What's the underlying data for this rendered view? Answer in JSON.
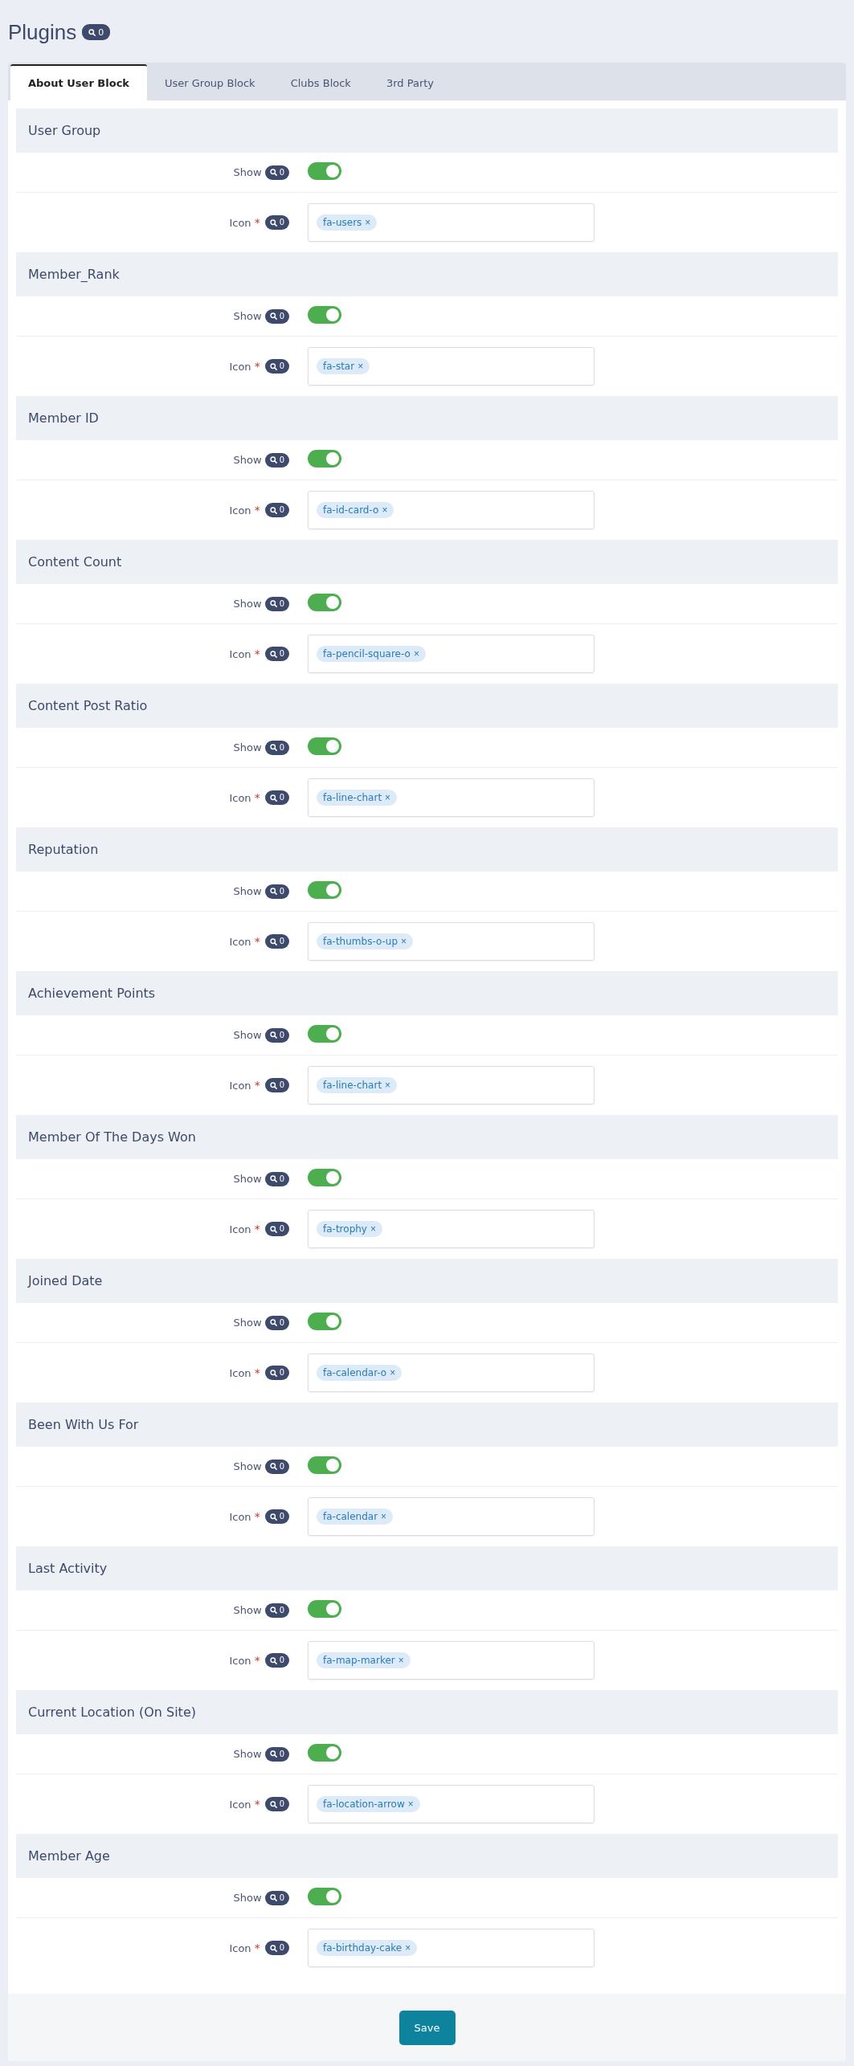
{
  "page": {
    "title": "Plugins",
    "badge": "0"
  },
  "tabs": [
    {
      "label": "About User Block",
      "selected": true
    },
    {
      "label": "User Group Block",
      "selected": false
    },
    {
      "label": "Clubs Block",
      "selected": false
    },
    {
      "label": "3rd Party",
      "selected": false
    }
  ],
  "sections": [
    {
      "title": "User Group",
      "show": {
        "label": "Show",
        "badge": "0",
        "on": true
      },
      "icon": {
        "label": "Icon",
        "required_mark": "*",
        "badge": "0",
        "tags": [
          {
            "text": "fa-users",
            "remove": "×"
          }
        ]
      }
    },
    {
      "title": "Member_Rank",
      "show": {
        "label": "Show",
        "badge": "0",
        "on": true
      },
      "icon": {
        "label": "Icon",
        "required_mark": "*",
        "badge": "0",
        "tags": [
          {
            "text": "fa-star",
            "remove": "×"
          }
        ]
      }
    },
    {
      "title": "Member ID",
      "show": {
        "label": "Show",
        "badge": "0",
        "on": true
      },
      "icon": {
        "label": "Icon",
        "required_mark": "*",
        "badge": "0",
        "tags": [
          {
            "text": "fa-id-card-o",
            "remove": "×"
          }
        ]
      }
    },
    {
      "title": "Content Count",
      "show": {
        "label": "Show",
        "badge": "0",
        "on": true
      },
      "icon": {
        "label": "Icon",
        "required_mark": "*",
        "badge": "0",
        "tags": [
          {
            "text": "fa-pencil-square-o",
            "remove": "×"
          }
        ]
      }
    },
    {
      "title": "Content Post Ratio",
      "show": {
        "label": "Show",
        "badge": "0",
        "on": true
      },
      "icon": {
        "label": "Icon",
        "required_mark": "*",
        "badge": "0",
        "tags": [
          {
            "text": "fa-line-chart",
            "remove": "×"
          }
        ]
      }
    },
    {
      "title": "Reputation",
      "show": {
        "label": "Show",
        "badge": "0",
        "on": true
      },
      "icon": {
        "label": "Icon",
        "required_mark": "*",
        "badge": "0",
        "tags": [
          {
            "text": "fa-thumbs-o-up",
            "remove": "×"
          }
        ]
      }
    },
    {
      "title": "Achievement Points",
      "show": {
        "label": "Show",
        "badge": "0",
        "on": true
      },
      "icon": {
        "label": "Icon",
        "required_mark": "*",
        "badge": "0",
        "tags": [
          {
            "text": "fa-line-chart",
            "remove": "×"
          }
        ]
      }
    },
    {
      "title": "Member Of The Days Won",
      "show": {
        "label": "Show",
        "badge": "0",
        "on": true
      },
      "icon": {
        "label": "Icon",
        "required_mark": "*",
        "badge": "0",
        "tags": [
          {
            "text": "fa-trophy",
            "remove": "×"
          }
        ]
      }
    },
    {
      "title": "Joined Date",
      "show": {
        "label": "Show",
        "badge": "0",
        "on": true
      },
      "icon": {
        "label": "Icon",
        "required_mark": "*",
        "badge": "0",
        "tags": [
          {
            "text": "fa-calendar-o",
            "remove": "×"
          }
        ]
      }
    },
    {
      "title": "Been With Us For",
      "show": {
        "label": "Show",
        "badge": "0",
        "on": true
      },
      "icon": {
        "label": "Icon",
        "required_mark": "*",
        "badge": "0",
        "tags": [
          {
            "text": "fa-calendar",
            "remove": "×"
          }
        ]
      }
    },
    {
      "title": "Last Activity",
      "show": {
        "label": "Show",
        "badge": "0",
        "on": true
      },
      "icon": {
        "label": "Icon",
        "required_mark": "*",
        "badge": "0",
        "tags": [
          {
            "text": "fa-map-marker",
            "remove": "×"
          }
        ]
      }
    },
    {
      "title": "Current Location (On Site)",
      "show": {
        "label": "Show",
        "badge": "0",
        "on": true
      },
      "icon": {
        "label": "Icon",
        "required_mark": "*",
        "badge": "0",
        "tags": [
          {
            "text": "fa-location-arrow",
            "remove": "×"
          }
        ]
      }
    },
    {
      "title": "Member Age",
      "show": {
        "label": "Show",
        "badge": "0",
        "on": true
      },
      "icon": {
        "label": "Icon",
        "required_mark": "*",
        "badge": "0",
        "tags": [
          {
            "text": "fa-birthday-cake",
            "remove": "×"
          }
        ]
      }
    }
  ],
  "save_button": "Save"
}
